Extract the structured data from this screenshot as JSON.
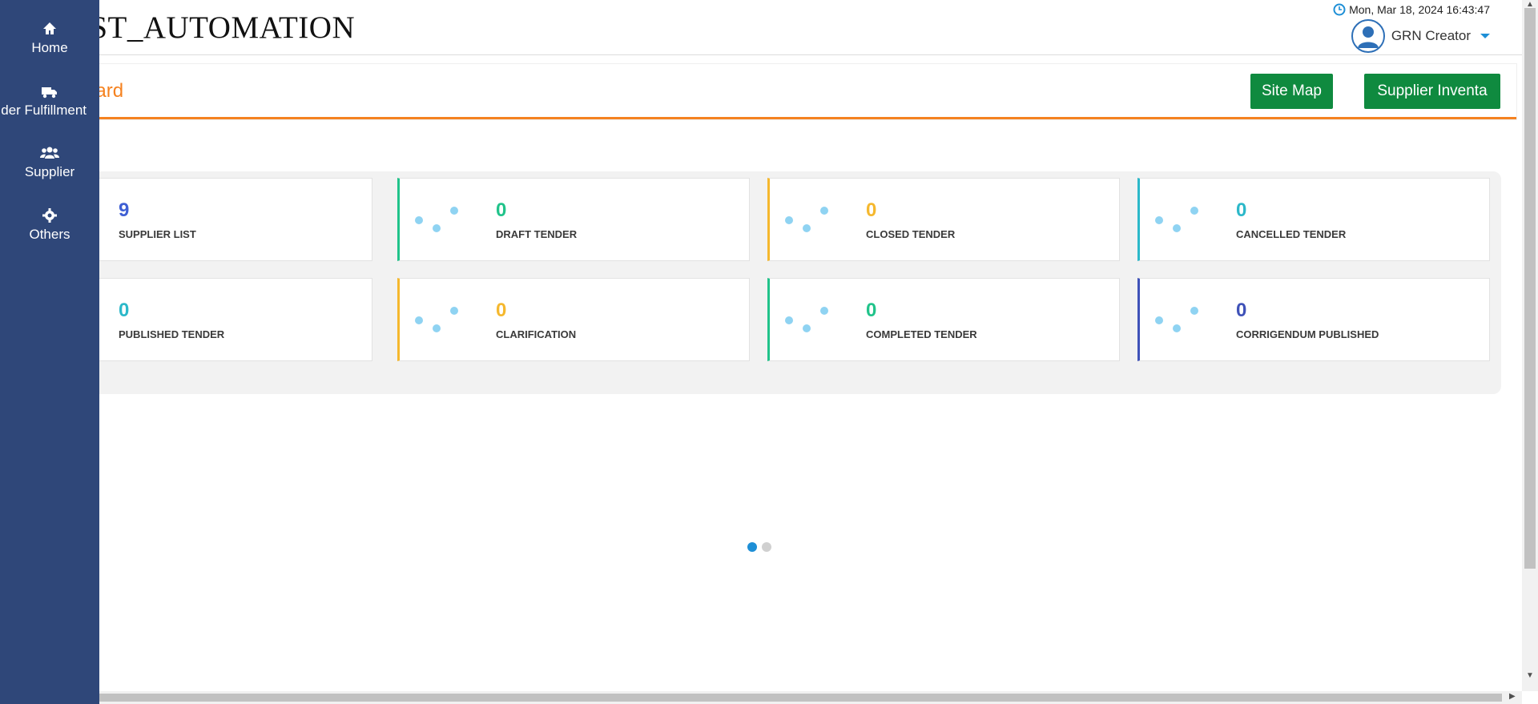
{
  "header": {
    "app_title": "EST_AUTOMATION",
    "datetime": "Mon, Mar 18, 2024 16:43:47",
    "user_name": "GRN Creator"
  },
  "sidebar": {
    "items": [
      {
        "label": "Home",
        "icon": "home-icon"
      },
      {
        "label": "der Fulfillment",
        "icon": "truck-icon"
      },
      {
        "label": "Supplier",
        "icon": "users-icon"
      },
      {
        "label": "Others",
        "icon": "gear-icon"
      }
    ]
  },
  "page": {
    "heading": "oard",
    "buttons": {
      "site_map": "Site Map",
      "supplier_inventory": "Supplier Inventa"
    }
  },
  "stats": [
    {
      "value": "9",
      "label": "SUPPLIER LIST",
      "color": "#3f5fd4"
    },
    {
      "value": "0",
      "label": "DRAFT TENDER",
      "color": "#21c38a"
    },
    {
      "value": "0",
      "label": "CLOSED TENDER",
      "color": "#f5b82e"
    },
    {
      "value": "0",
      "label": "CANCELLED TENDER",
      "color": "#2cb8c9"
    },
    {
      "value": "0",
      "label": "PUBLISHED TENDER",
      "color": "#2cb8c9"
    },
    {
      "value": "0",
      "label": "CLARIFICATION",
      "color": "#f5b82e"
    },
    {
      "value": "0",
      "label": "COMPLETED TENDER",
      "color": "#21c38a"
    },
    {
      "value": "0",
      "label": "CORRIGENDUM PUBLISHED",
      "color": "#3f52b8"
    }
  ],
  "carousel": {
    "pages": 2,
    "active": 1
  },
  "colors": {
    "sidebar": "#2f4779",
    "accent": "#f58220",
    "button": "#0f8a3f",
    "dots": "#8fd3f2"
  }
}
